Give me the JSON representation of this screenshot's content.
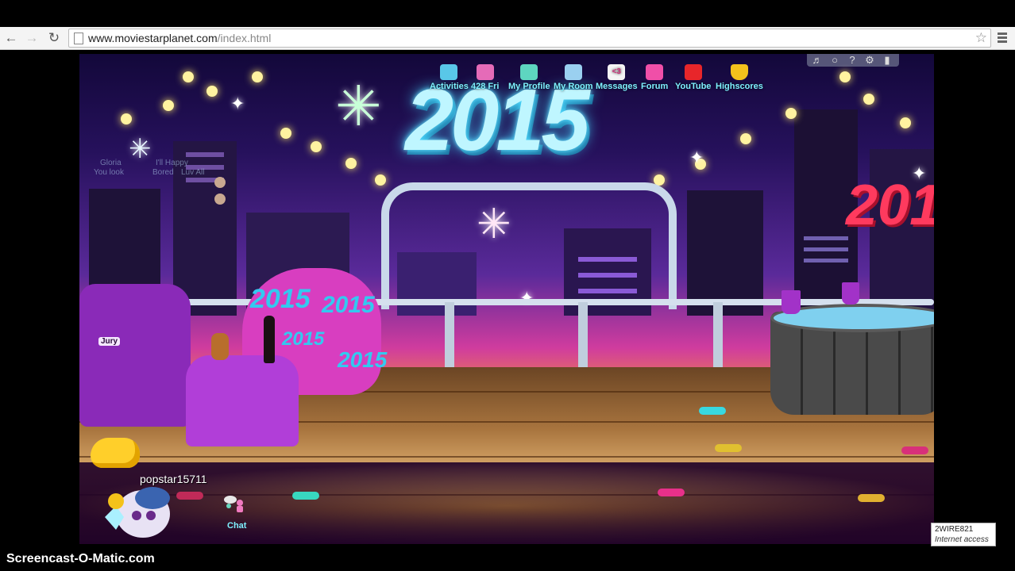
{
  "browser": {
    "url_host": "www.moviestarplanet.com",
    "url_path": "/index.html"
  },
  "game": {
    "sign_text": "2015",
    "balloon_text": "2015",
    "beanbag_text": "2015",
    "nav": [
      {
        "label": "Activities",
        "icon": "activities-icon",
        "color": "#59c7e8"
      },
      {
        "label": "428 Fri",
        "icon": "friends-icon",
        "color": "#e56bb8"
      },
      {
        "label": "My Profile",
        "icon": "profile-icon",
        "color": "#5ed6c0"
      },
      {
        "label": "My Room",
        "icon": "room-icon",
        "color": "#9ad0f0"
      },
      {
        "label": "Messages",
        "icon": "messages-icon",
        "badge": "<3",
        "color": "#f4f4f4"
      },
      {
        "label": "Forum",
        "icon": "forum-icon",
        "color": "#f04fa8"
      },
      {
        "label": "YouTube",
        "icon": "youtube-icon",
        "color": "#e8262a"
      },
      {
        "label": "Highscores",
        "icon": "trophy-icon",
        "color": "#f3c21c"
      }
    ],
    "tools": [
      "sound-icon",
      "circle-icon",
      "help-icon",
      "settings-icon",
      "fullscreen-icon"
    ],
    "help_symbol": "?",
    "ghost_chat": [
      "Gloria",
      "You look",
      "I'll Happy",
      "Bored",
      "Luv All"
    ],
    "jury_label": "Jury",
    "username": "popstar15711",
    "chat_label": "Chat"
  },
  "overlay": {
    "watermark": "Screencast-O-Matic.com",
    "wifi_name": "2WIRE821",
    "wifi_status": "Internet access"
  }
}
